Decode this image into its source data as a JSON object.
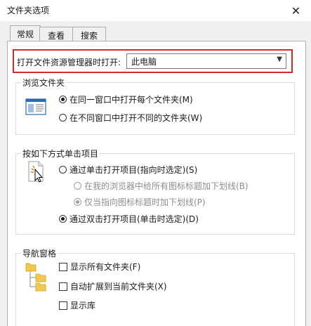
{
  "window": {
    "title": "文件夹选项",
    "close_glyph": "✕"
  },
  "tabs": [
    {
      "label": "常规",
      "active": true
    },
    {
      "label": "查看",
      "active": false
    },
    {
      "label": "搜索",
      "active": false
    }
  ],
  "open_explorer": {
    "label": "打开文件资源管理器时打开:",
    "value": "此电脑"
  },
  "browse_folders": {
    "title": "浏览文件夹",
    "icon": "window-icon",
    "options": [
      {
        "label": "在同一窗口中打开每个文件夹(M)",
        "selected": true
      },
      {
        "label": "在不同窗口中打开不同的文件夹(W)",
        "selected": false
      }
    ]
  },
  "click_items": {
    "title": "按如下方式单击项目",
    "icon": "cursor-icon",
    "options": [
      {
        "label": "通过单击打开项目(指向时选定)(S)",
        "selected": false
      },
      {
        "label": "在我的浏览器中给所有图标标题加下划线(B)",
        "selected": false,
        "disabled": true
      },
      {
        "label": "仅当指向图标标题时加下划线(P)",
        "selected": true,
        "disabled": true
      },
      {
        "label": "通过双击打开项目(单击时选定)(D)",
        "selected": true
      }
    ]
  },
  "nav_pane": {
    "title": "导航窗格",
    "icon": "folder-tree-icon",
    "options": [
      {
        "label": "显示所有文件夹(F)",
        "checked": false
      },
      {
        "label": "自动扩展到当前文件夹(X)",
        "checked": false
      },
      {
        "label": "显示库",
        "checked": false
      }
    ]
  }
}
